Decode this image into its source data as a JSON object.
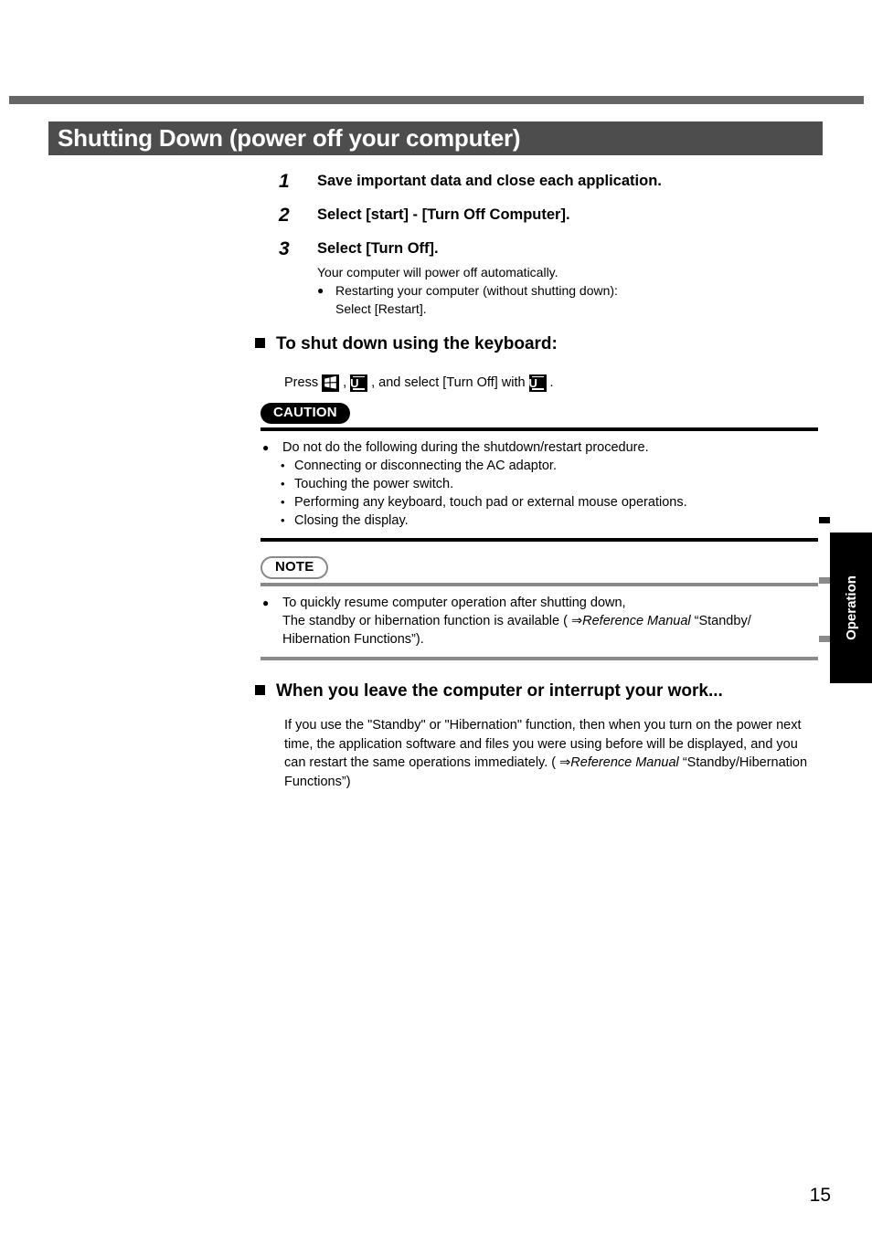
{
  "page": {
    "title": "Shutting Down (power off your computer)",
    "number": "15",
    "side_tab_label": "Operation"
  },
  "steps": [
    {
      "number": "1",
      "heading": "Save important data and close each application."
    },
    {
      "number": "2",
      "heading": "Select [start] - [Turn Off Computer]."
    },
    {
      "number": "3",
      "heading": "Select [Turn Off].",
      "sub_text": "Your computer will power off automatically.",
      "bullets": [
        "Restarting your computer (without shutting down):",
        "Select [Restart]."
      ]
    }
  ],
  "keyboard_section": {
    "heading": "To shut down using the keyboard:",
    "press_prefix": "Press",
    "key_windows": "windows-key",
    "separator_comma": ",",
    "key_u_first": "U",
    "middle_text": ", and select [Turn Off] with",
    "key_u_second": "U",
    "period": "."
  },
  "caution": {
    "badge": "CAUTION",
    "bullet": "Do not do the following during the shutdown/restart procedure.",
    "items": [
      "Connecting or disconnecting the AC adaptor.",
      "Touching the power switch.",
      "Performing any keyboard, touch pad or external mouse operations.",
      "Closing the display."
    ]
  },
  "note": {
    "badge": "NOTE",
    "line1": "To quickly resume computer operation after shutting down,",
    "line2_before": "The standby or hibernation function is available ( ⇒",
    "line2_italic": "Reference Manual",
    "line2_after": " “Standby/",
    "line3": "Hibernation Functions”)."
  },
  "leave_section": {
    "heading": "When you leave the computer or interrupt your work...",
    "body_before": "If you use the \"Standby\" or \"Hibernation\" function, then when you turn on the power next time, the application software and files you were using before will be displayed, and you can restart the same operations immediately. ( ⇒",
    "body_italic": "Reference Manual",
    "body_after": " “Standby/Hibernation Functions”)"
  },
  "colors": {
    "top_rule": "#656565",
    "title_bar": "#4d4d4d",
    "caution_rule": "#000000",
    "note_rule": "#8a8a8a",
    "side_tab": "#000000"
  }
}
